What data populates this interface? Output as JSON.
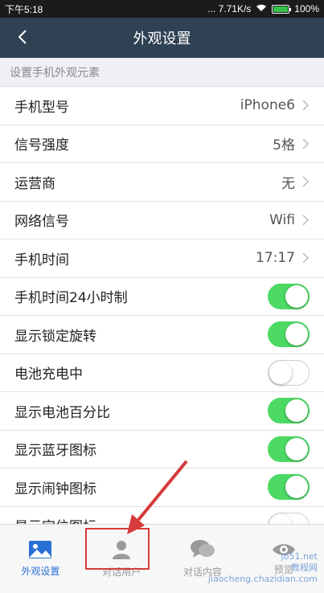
{
  "status": {
    "time": "下午5:18",
    "network": "... 7.71K/s",
    "battery": "100%"
  },
  "nav": {
    "title": "外观设置"
  },
  "section": {
    "title": "设置手机外观元素"
  },
  "rows": [
    {
      "label": "手机型号",
      "value": "iPhone6"
    },
    {
      "label": "信号强度",
      "value": "5格"
    },
    {
      "label": "运营商",
      "value": "无"
    },
    {
      "label": "网络信号",
      "value": "Wifi"
    },
    {
      "label": "手机时间",
      "value": "17:17"
    },
    {
      "label": "手机时间24小时制",
      "toggle": true
    },
    {
      "label": "显示锁定旋转",
      "toggle": true
    },
    {
      "label": "电池充电中",
      "toggle": false
    },
    {
      "label": "显示电池百分比",
      "toggle": true
    },
    {
      "label": "显示蓝牙图标",
      "toggle": true
    },
    {
      "label": "显示闹钟图标",
      "toggle": true
    },
    {
      "label": "显示定位图标",
      "toggle": false
    }
  ],
  "tabs": [
    {
      "label": "外观设置",
      "icon": "image-icon",
      "active": true
    },
    {
      "label": "对话用户",
      "icon": "user-icon",
      "active": false
    },
    {
      "label": "对话内容",
      "icon": "chat-icon",
      "active": false
    },
    {
      "label": "预览",
      "icon": "eye-icon",
      "active": false
    }
  ],
  "watermark": {
    "line1": "jb51.net",
    "line2": "教程网",
    "line3": "jiaocheng.chazidian.com"
  },
  "colors": {
    "nav": "#2f4253",
    "toggle_on": "#4cd964",
    "tab_active": "#2a6fd6",
    "highlight": "#d63b3b"
  }
}
